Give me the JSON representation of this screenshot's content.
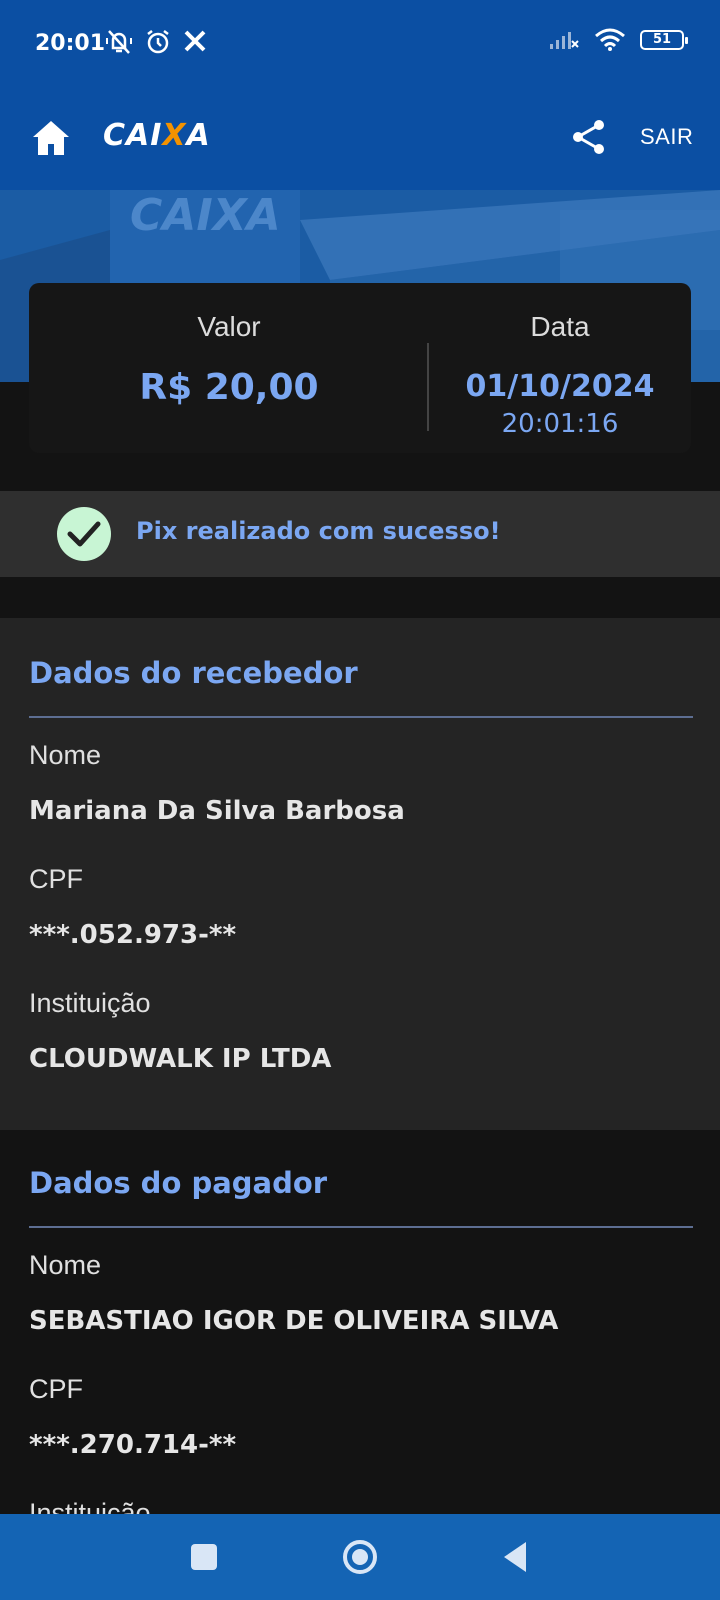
{
  "status_bar": {
    "time": "20:01",
    "left_icons": [
      "mute-bell-icon",
      "alarm-icon",
      "x-app-icon"
    ],
    "right_icons": [
      "signal-off-icon",
      "wifi-icon"
    ],
    "battery": "51"
  },
  "app_bar": {
    "logo_text_pre": "CAI",
    "logo_text_x": "X",
    "logo_text_post": "A",
    "sair_label": "SAIR",
    "colors": {
      "bar": "#0b4fa3",
      "logo_accent": "#f39200"
    }
  },
  "banner": {
    "sign_text": "CAIXA"
  },
  "summary": {
    "valor_label": "Valor",
    "valor": "R$ 20,00",
    "data_label": "Data",
    "date": "01/10/2024",
    "time": "20:01:16"
  },
  "success": {
    "message": "Pix realizado com sucesso!",
    "icon": "check-circle-icon",
    "icon_color": "#c8f5d4"
  },
  "recebedor": {
    "title": "Dados do recebedor",
    "nome_label": "Nome",
    "nome": "Mariana Da Silva Barbosa",
    "cpf_label": "CPF",
    "cpf": "***.052.973-**",
    "instituicao_label": "Instituição",
    "instituicao": "CLOUDWALK IP LTDA"
  },
  "pagador": {
    "title": "Dados do pagador",
    "nome_label": "Nome",
    "nome": "SEBASTIAO IGOR DE OLIVEIRA SILVA",
    "cpf_label": "CPF",
    "cpf": "***.270.714-**",
    "instituicao_label": "Instituição"
  },
  "nav": {
    "icons": [
      "recents-square-icon",
      "home-circle-icon",
      "back-triangle-icon"
    ]
  }
}
